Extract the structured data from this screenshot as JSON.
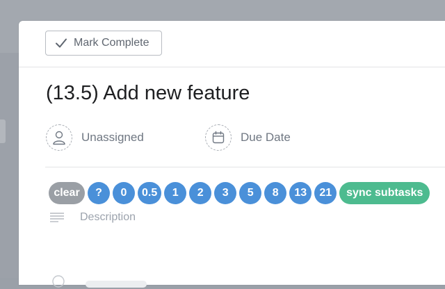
{
  "toolbar": {
    "mark_complete_label": "Mark Complete"
  },
  "task": {
    "title": "(13.5) Add new feature",
    "assignee_label": "Unassigned",
    "due_date_label": "Due Date",
    "description_placeholder": "Description"
  },
  "estimate_pills": [
    {
      "label": "clear",
      "kind": "clear"
    },
    {
      "label": "?",
      "kind": "num"
    },
    {
      "label": "0",
      "kind": "num"
    },
    {
      "label": "0.5",
      "kind": "num"
    },
    {
      "label": "1",
      "kind": "num"
    },
    {
      "label": "2",
      "kind": "num"
    },
    {
      "label": "3",
      "kind": "num"
    },
    {
      "label": "5",
      "kind": "num"
    },
    {
      "label": "8",
      "kind": "num"
    },
    {
      "label": "13",
      "kind": "num"
    },
    {
      "label": "21",
      "kind": "num"
    },
    {
      "label": "sync subtasks",
      "kind": "sync"
    }
  ],
  "colors": {
    "clear_pill": "#9a9fa5",
    "number_pill": "#4a90d9",
    "sync_pill": "#4dbb8f",
    "title_text": "#1e1f21",
    "muted_text": "#6f7782"
  },
  "icons": {
    "mark_complete": "checkmark-icon",
    "assignee": "user-icon",
    "due_date": "calendar-icon",
    "description": "text-lines-icon"
  }
}
